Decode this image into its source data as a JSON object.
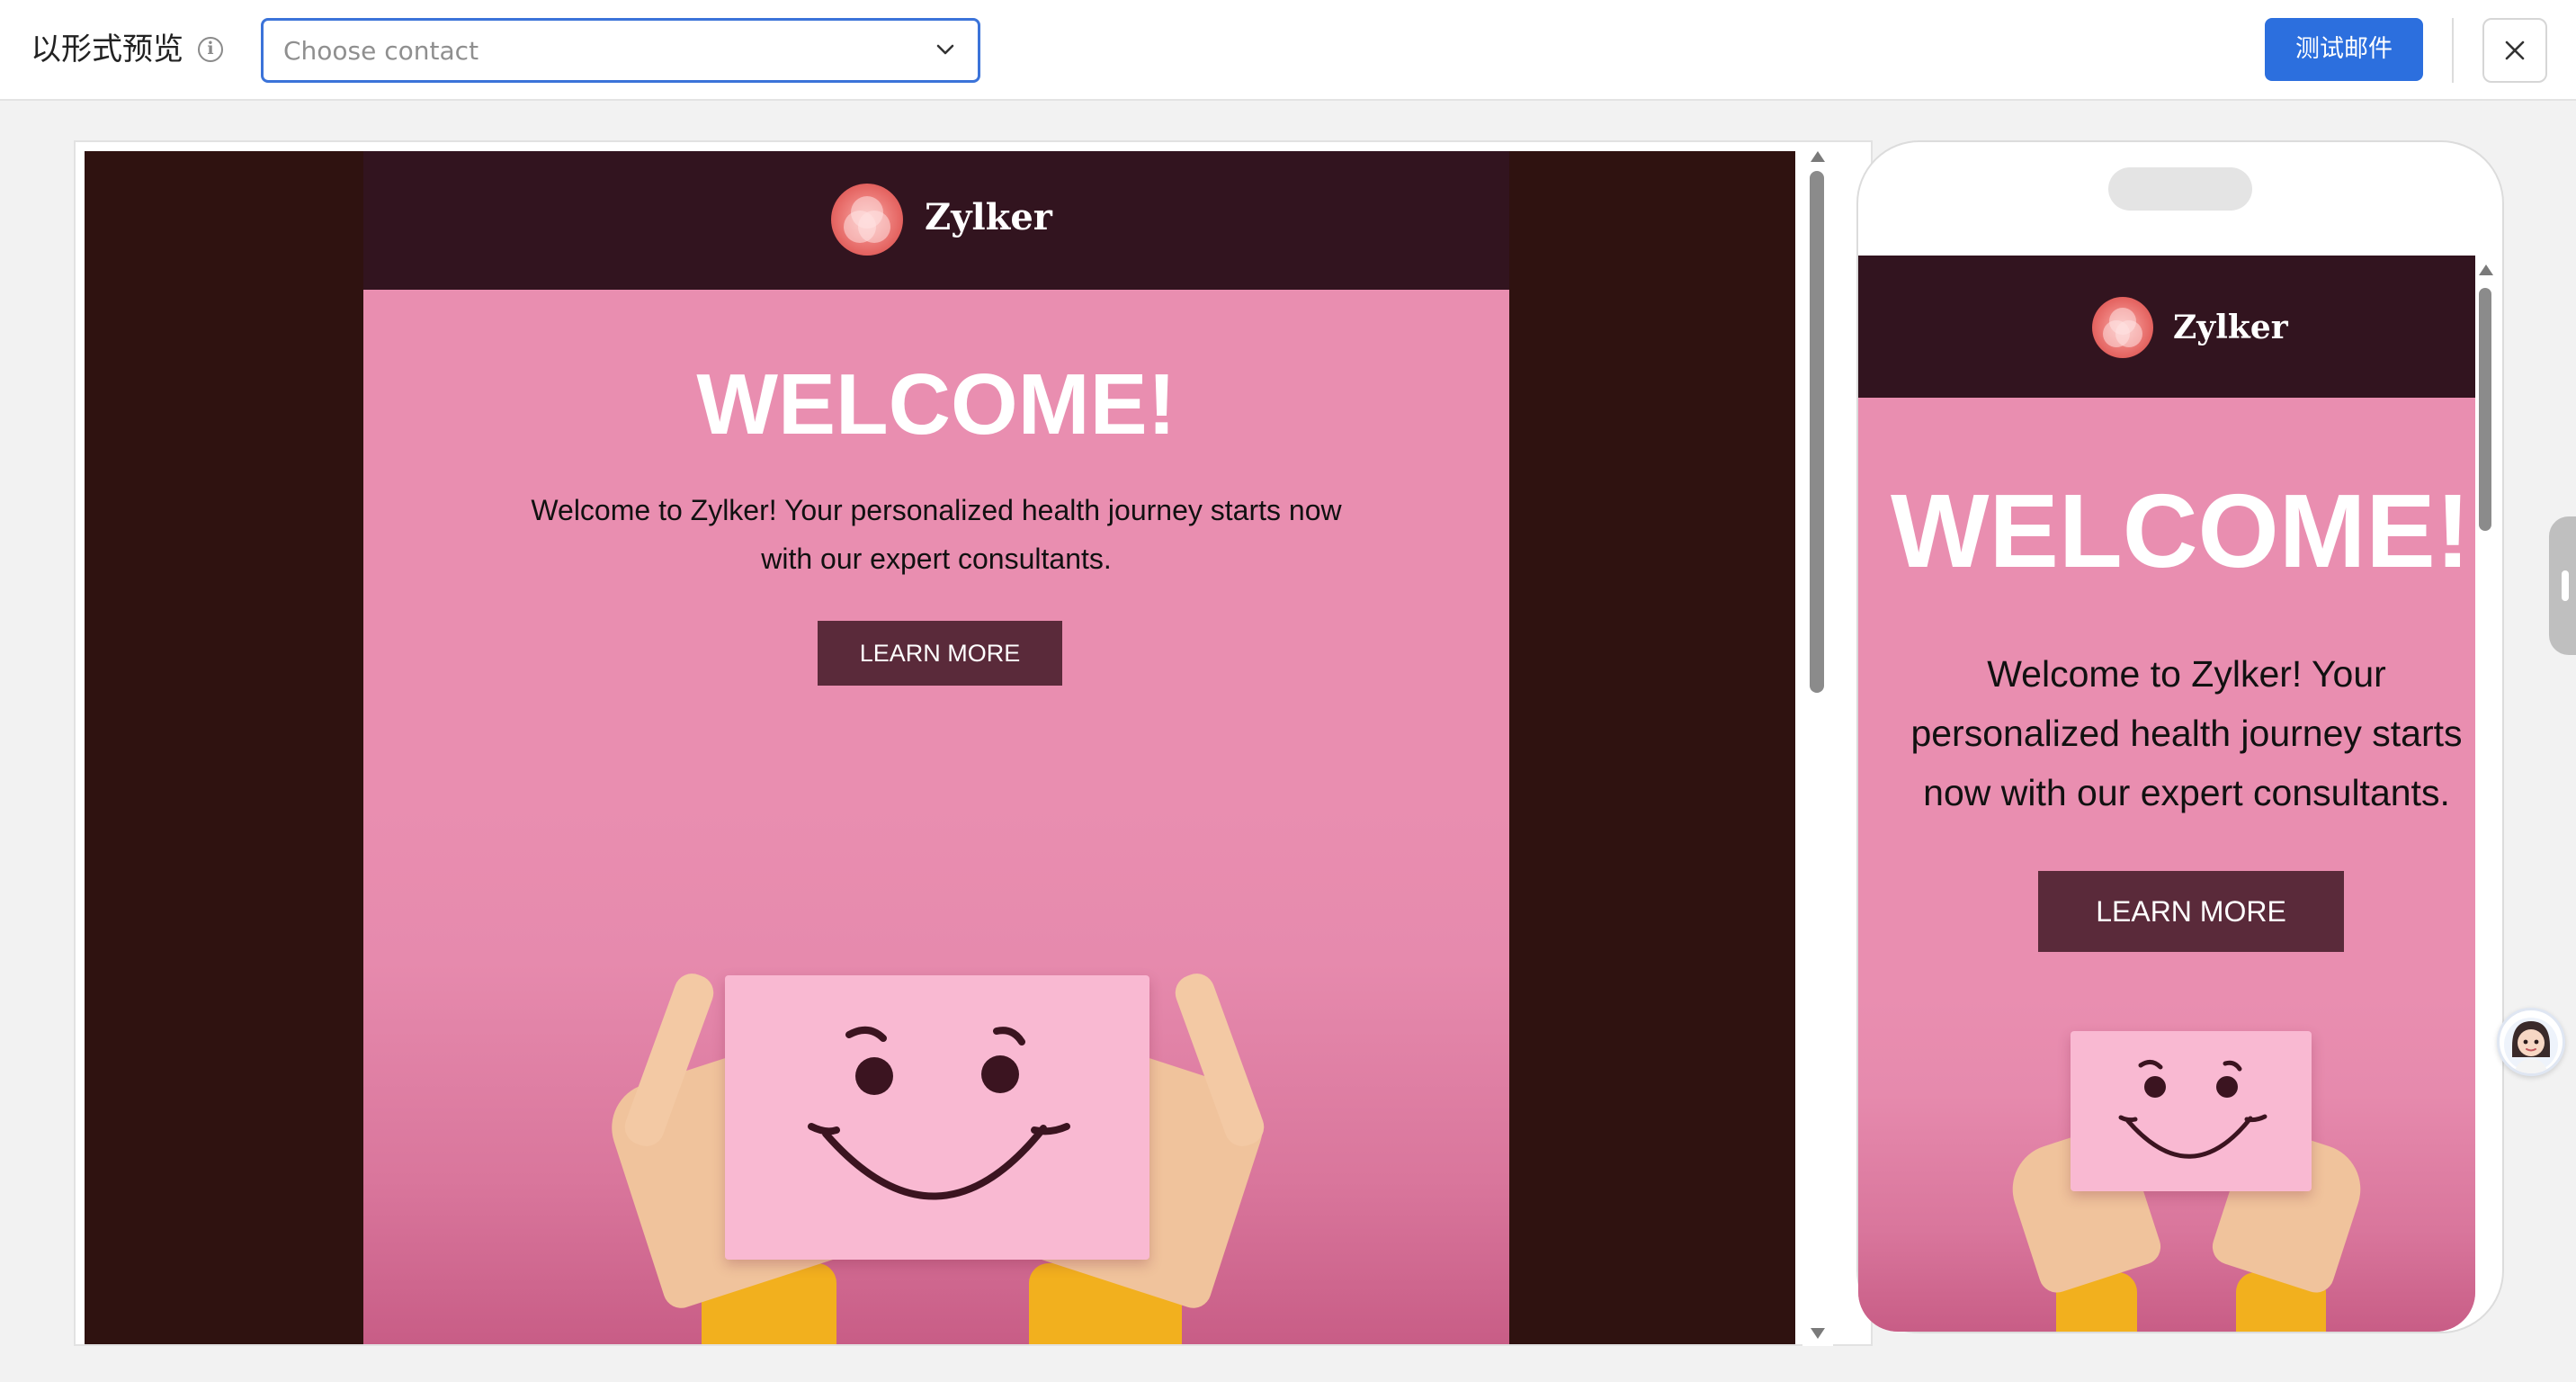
{
  "header": {
    "title": "以形式预览",
    "contact_placeholder": "Choose contact",
    "test_button": "测试邮件"
  },
  "icons": {
    "info": "info-icon",
    "dropdown": "chevron-down-icon",
    "close": "close-icon"
  },
  "email": {
    "brand": "Zylker",
    "heading": "WELCOME!",
    "body": "Welcome to Zylker! Your personalized health journey starts now with our expert consultants.",
    "cta": "LEARN MORE"
  },
  "colors": {
    "outer_background": "#2f1210",
    "header_background": "#32141f",
    "email_background": "#e98eb0",
    "cta_background": "#5a2a3a",
    "accent": "#2c6fde"
  }
}
